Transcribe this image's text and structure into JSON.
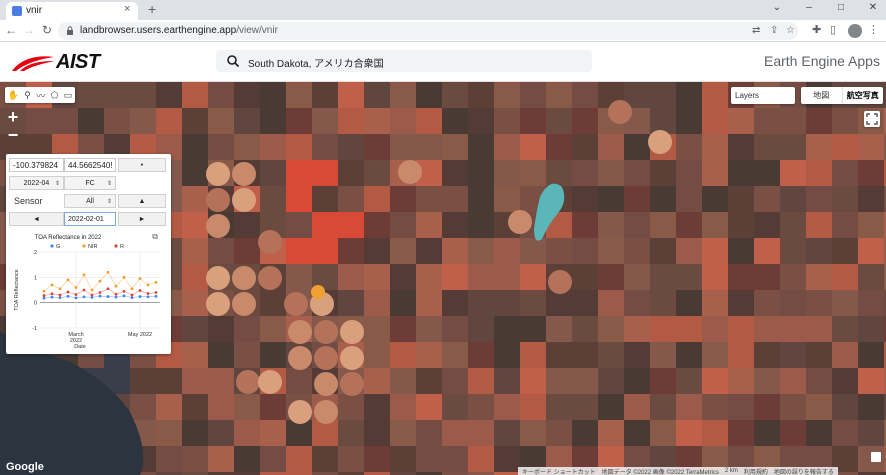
{
  "browser": {
    "tab_title": "vnir",
    "tab_close": "×",
    "new_tab": "+",
    "url_host": "landbrowser.users.earthengine.app",
    "url_path": "/view/vnir",
    "window_controls": [
      "⌄",
      "–",
      "□",
      "✕"
    ]
  },
  "app": {
    "logo_text": "AIST",
    "brand_color": "#e60012",
    "search_value": "South Dakota, アメリカ合衆国",
    "title": "Earth Engine Apps"
  },
  "map": {
    "layers_label": "Layers",
    "maptype_map": "地図",
    "maptype_satellite": "航空写真",
    "zoom_in": "+",
    "zoom_out": "−",
    "google": "Google",
    "attribution": [
      "キーボード ショートカット",
      "地図データ ©2022 画像 ©2022 TerraMetrics",
      "2 km",
      "利用規約",
      "地図の誤りを報告する"
    ]
  },
  "panel": {
    "lon": "-100.379824",
    "lat": "44.5662540!",
    "dot_button": "•",
    "month": "2022-04",
    "composite": "FC",
    "sensor_label": "Sensor",
    "sensor_value": "All",
    "up_button": "▲",
    "prev_button": "◄",
    "date": "2022-02-01",
    "next_button": "►"
  },
  "chart_data": {
    "type": "scatter",
    "title": "TOA Reflectance in 2022",
    "xlabel": "Date",
    "ylabel": "TOA Reflectance",
    "ylim": [
      -1,
      2
    ],
    "yticks": [
      "-1",
      "0",
      "1",
      "2"
    ],
    "xticks": [
      "March 2022",
      "May 2022"
    ],
    "legend_position": "top",
    "series": [
      {
        "name": "G",
        "color": "#4285f4",
        "values": [
          0.18,
          0.22,
          0.2,
          0.25,
          0.19,
          0.23,
          0.21,
          0.26,
          0.24,
          0.22,
          0.27,
          0.2,
          0.24,
          0.23,
          0.25
        ]
      },
      {
        "name": "NIR",
        "color": "#f0a030",
        "values": [
          0.45,
          0.7,
          0.55,
          0.9,
          0.6,
          1.1,
          0.5,
          0.85,
          1.2,
          0.65,
          1.0,
          0.55,
          0.95,
          0.7,
          0.8
        ]
      },
      {
        "name": "R",
        "color": "#db4437",
        "values": [
          0.28,
          0.35,
          0.3,
          0.42,
          0.32,
          0.5,
          0.3,
          0.4,
          0.55,
          0.33,
          0.45,
          0.3,
          0.48,
          0.36,
          0.4
        ]
      }
    ],
    "x": [
      "2022-02-05",
      "2022-02-12",
      "2022-02-20",
      "2022-02-27",
      "2022-03-07",
      "2022-03-15",
      "2022-03-22",
      "2022-03-30",
      "2022-04-07",
      "2022-04-14",
      "2022-04-22",
      "2022-04-29",
      "2022-05-07",
      "2022-05-15",
      "2022-05-22"
    ]
  }
}
